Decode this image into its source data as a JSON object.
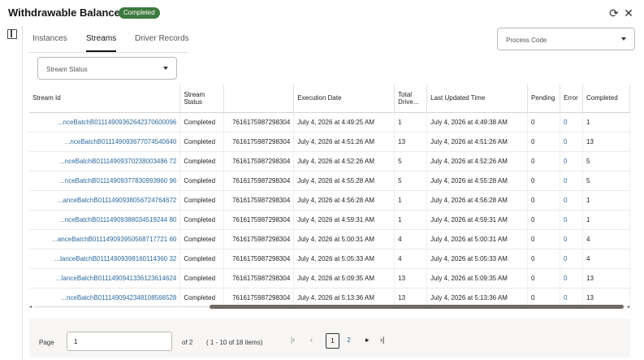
{
  "header": {
    "title": "Withdrawable Balance",
    "badge": "Completed",
    "refresh_icon": "refresh-icon",
    "close_icon": "close-icon"
  },
  "sidebar": {
    "panel_icon": "panel-toggle-icon"
  },
  "tabs": [
    {
      "label": "Instances",
      "active": false
    },
    {
      "label": "Streams",
      "active": true
    },
    {
      "label": "Driver Records",
      "active": false
    }
  ],
  "filters": {
    "process_code": "Process Code",
    "stream_status": "Stream Status"
  },
  "table": {
    "columns": [
      "Stream Id",
      "Stream Status",
      "",
      "Execution Date",
      "Total Drive...",
      "Last Updated Time",
      "Pending",
      "Error",
      "Completed"
    ],
    "rows": [
      [
        "...nceBatchB01114909362642370600096",
        "Completed",
        "7616175987298304",
        "July 4, 2026 at 4:49:25 AM",
        "1",
        "July 4, 2026 at 4:49:38 AM",
        "0",
        "0",
        "1"
      ],
      [
        "...nceBatchB011149093677074540640",
        "Completed",
        "7616175987298304",
        "July 4, 2026 at 4:51:26 AM",
        "13",
        "July 4, 2026 at 4:51:26 AM",
        "0",
        "0",
        "13"
      ],
      [
        "...nceBatchB01114909370238003486 72",
        "Completed",
        "7616175987298304",
        "July 4, 2026 at 4:52:26 AM",
        "5",
        "July 4, 2026 at 4:52:26 AM",
        "0",
        "0",
        "5"
      ],
      [
        "...nceBatchB01114909377830993960 96",
        "Completed",
        "7616175987298304",
        "July 4, 2026 at 4:55:28 AM",
        "5",
        "July 4, 2026 at 4:55:28 AM",
        "0",
        "0",
        "5"
      ],
      [
        "...anceBatchB0111490938056724764672",
        "Completed",
        "7616175987298304",
        "July 4, 2026 at 4:56:28 AM",
        "1",
        "July 4, 2026 at 4:56:28 AM",
        "0",
        "0",
        "1"
      ],
      [
        "...nceBatchB01114909388034519244 80",
        "Completed",
        "7616175987298304",
        "July 4, 2026 at 4:59:31 AM",
        "1",
        "July 4, 2026 at 4:59:31 AM",
        "0",
        "0",
        "1"
      ],
      [
        "...anceBatchB011149093950568717721 60",
        "Completed",
        "7616175987298304",
        "July 4, 2026 at 5:00:31 AM",
        "4",
        "July 4, 2026 at 5:00:31 AM",
        "0",
        "0",
        "4"
      ],
      [
        "...lanceBatchB01114909398160114360 32",
        "Completed",
        "7616175987298304",
        "July 4, 2026 at 5:05:33 AM",
        "4",
        "July 4, 2026 at 5:05:33 AM",
        "0",
        "0",
        "4"
      ],
      [
        "...lanceBatchB0111490941336123614624",
        "Completed",
        "7616175987298304",
        "July 4, 2026 at 5:09:35 AM",
        "13",
        "July 4, 2026 at 5:09:35 AM",
        "0",
        "0",
        "13"
      ],
      [
        "...nceBatchB0111490942348108566528",
        "Completed",
        "7616175987298304",
        "July 4, 2026 at 5:13:36 AM",
        "13",
        "July 4, 2026 at 5:13:36 AM",
        "0",
        "0",
        "13"
      ]
    ]
  },
  "pagination": {
    "page_label": "Page",
    "page_value": "1",
    "of_label": "of 2",
    "range_label": "( 1 - 10 of 18 items)",
    "pages": [
      "1",
      "2"
    ],
    "current_page": "1",
    "first_icon": "first-page-icon",
    "prev_icon": "previous-page-icon",
    "next_icon": "next-page-icon",
    "last_icon": "last-page-icon"
  },
  "colors": {
    "badge": "#3d7a3f",
    "link": "#2b6aa0",
    "scroll_thumb": "#6f6b66"
  }
}
